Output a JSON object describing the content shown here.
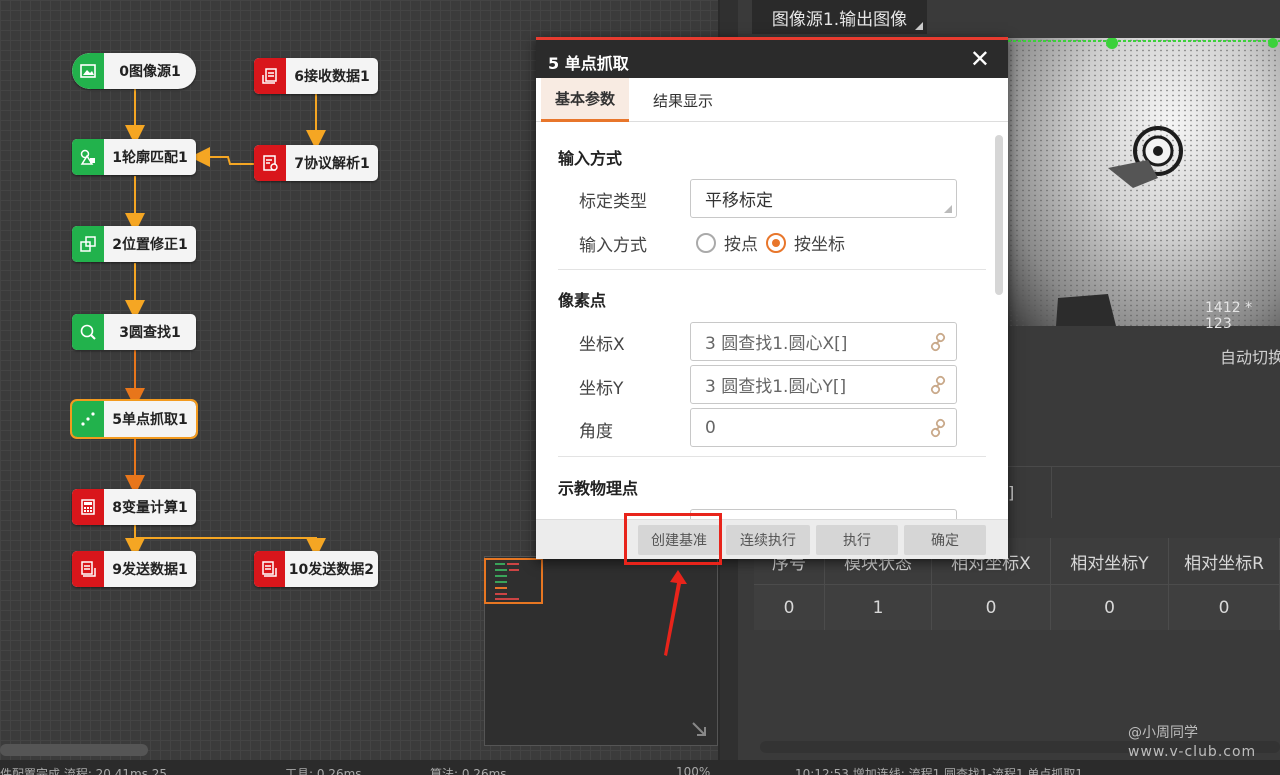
{
  "flow_nodes": [
    {
      "id": "n0",
      "label": "0图像源1",
      "color": "green",
      "icon": "image-icon"
    },
    {
      "id": "n1",
      "label": "1轮廓匹配1",
      "color": "green",
      "icon": "shapes-icon"
    },
    {
      "id": "n2",
      "label": "2位置修正1",
      "color": "green",
      "icon": "position-fix-icon"
    },
    {
      "id": "n3",
      "label": "3圆查找1",
      "color": "green",
      "icon": "circle-search-icon"
    },
    {
      "id": "n5",
      "label": "5单点抓取1",
      "color": "green",
      "icon": "point-grab-icon"
    },
    {
      "id": "n6",
      "label": "6接收数据1",
      "color": "red",
      "icon": "receive-data-icon"
    },
    {
      "id": "n7",
      "label": "7协议解析1",
      "color": "red",
      "icon": "protocol-parse-icon"
    },
    {
      "id": "n8",
      "label": "8变量计算1",
      "color": "red",
      "icon": "calculator-icon"
    },
    {
      "id": "n9",
      "label": "9发送数据1",
      "color": "red",
      "icon": "send-data-icon"
    },
    {
      "id": "n10",
      "label": "10发送数据2",
      "color": "red",
      "icon": "send-data-icon"
    }
  ],
  "right_panel": {
    "image_tab": "图像源1.输出图像",
    "image_size": "1412 * 123",
    "auto_switch": "自动切换",
    "table": {
      "headers": [
        "序号",
        "模块状态",
        "相对坐标X",
        "相对坐标Y",
        "相对坐标R"
      ],
      "rows": [
        [
          "0",
          "1",
          "0",
          "0",
          "0"
        ]
      ],
      "partial_cell": "]"
    }
  },
  "dialog": {
    "title": "5 单点抓取",
    "close": "✕",
    "tabs": [
      "基本参数",
      "结果显示"
    ],
    "active_tab": 0,
    "section_input": "输入方式",
    "calib_type_label": "标定类型",
    "calib_type_value": "平移标定",
    "input_mode_label": "输入方式",
    "radio_point": "按点",
    "radio_coord": "按坐标",
    "radio_selected": "按坐标",
    "section_pixel": "像素点",
    "coord_x_label": "坐标X",
    "coord_x_value": "3 圆查找1.圆心X[]",
    "coord_y_label": "坐标Y",
    "coord_y_value": "3 圆查找1.圆心Y[]",
    "angle_label": "角度",
    "angle_value": "0",
    "section_teach": "示教物理点",
    "buttons": {
      "create_base": "创建基准",
      "continuous": "连续执行",
      "execute": "执行",
      "confirm": "确定"
    }
  },
  "watermark": {
    "line1": "@小周同学",
    "line2": "www.v-club.com"
  },
  "status_bar": {
    "item1": "件配置完成  流程: 20.41ms   25",
    "item2": "工具: 0.26ms",
    "item3": "算法: 0.26ms",
    "zoom": "100%",
    "log": "10:12:53  增加连线: 流程1.圆查找1-流程1.单点抓取1"
  },
  "colors": {
    "accent": "#e8762b",
    "node_green": "#22b24c",
    "node_red": "#d9161b",
    "connector": "#f5a623",
    "highlight": "#e8241b"
  }
}
